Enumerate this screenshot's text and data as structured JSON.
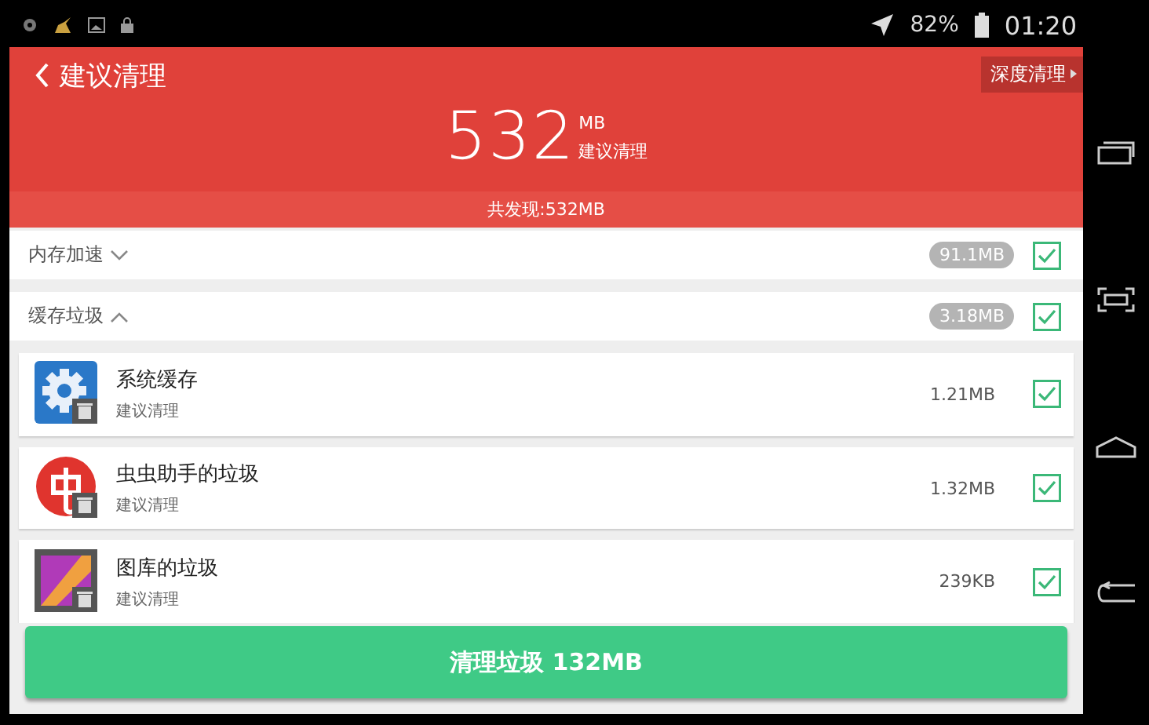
{
  "status_bar": {
    "battery": "82%",
    "time": "01:20"
  },
  "header": {
    "title": "建议清理",
    "deep_clean": "深度清理",
    "amount": "532",
    "unit": "MB",
    "amount_label": "建议清理",
    "found": "共发现:532MB"
  },
  "groups": [
    {
      "label": "内存加速",
      "expanded": false,
      "size": "91.1MB",
      "checked": true
    },
    {
      "label": "缓存垃圾",
      "expanded": true,
      "size": "3.18MB",
      "checked": true,
      "children": [
        {
          "kind": "settings",
          "name": "系统缓存",
          "subtitle": "建议清理",
          "size": "1.21MB",
          "checked": true
        },
        {
          "kind": "app",
          "name": "虫虫助手的垃圾",
          "subtitle": "建议清理",
          "size": "1.32MB",
          "checked": true
        },
        {
          "kind": "gallery",
          "name": "图库的垃圾",
          "subtitle": "建议清理",
          "size": "239KB",
          "checked": true
        }
      ]
    }
  ],
  "clean_button": "清理垃圾 132MB"
}
